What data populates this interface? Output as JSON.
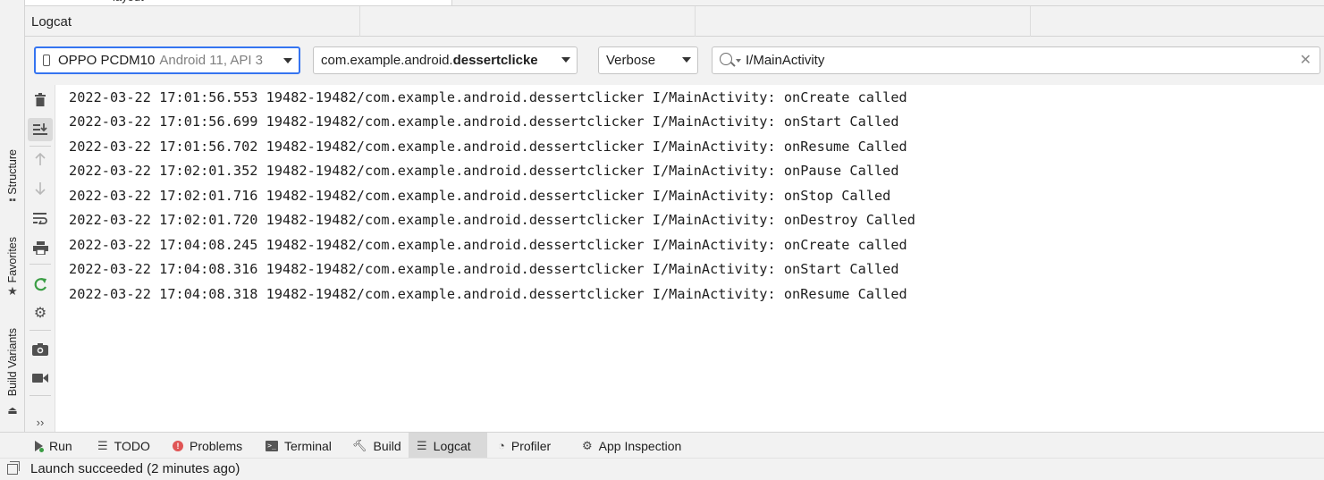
{
  "project_tree": {
    "partial_item": "layout"
  },
  "side_tabs": {
    "structure": "Structure",
    "favorites": "Favorites",
    "build_variants": "Build Variants"
  },
  "logcat": {
    "title": "Logcat",
    "device_select": {
      "device": "OPPO PCDM10",
      "detail": "Android 11, API 3"
    },
    "package_select": {
      "prefix": "com.example.android.",
      "bold": "dessertclicke"
    },
    "level_select": "Verbose",
    "search": {
      "value": "I/MainActivity",
      "clear_glyph": "✕"
    },
    "lines": [
      "2022-03-22 17:01:56.553 19482-19482/com.example.android.dessertclicker I/MainActivity: onCreate called",
      "2022-03-22 17:01:56.699 19482-19482/com.example.android.dessertclicker I/MainActivity: onStart Called",
      "2022-03-22 17:01:56.702 19482-19482/com.example.android.dessertclicker I/MainActivity: onResume Called",
      "2022-03-22 17:02:01.352 19482-19482/com.example.android.dessertclicker I/MainActivity: onPause Called",
      "2022-03-22 17:02:01.716 19482-19482/com.example.android.dessertclicker I/MainActivity: onStop Called",
      "2022-03-22 17:02:01.720 19482-19482/com.example.android.dessertclicker I/MainActivity: onDestroy Called",
      "2022-03-22 17:04:08.245 19482-19482/com.example.android.dessertclicker I/MainActivity: onCreate called",
      "2022-03-22 17:04:08.316 19482-19482/com.example.android.dessertclicker I/MainActivity: onStart Called",
      "2022-03-22 17:04:08.318 19482-19482/com.example.android.dessertclicker I/MainActivity: onResume Called"
    ]
  },
  "side_tools": {
    "more_glyph": "››",
    "icons": [
      "trash-icon",
      "scroll-to-end-icon",
      "up-arrow-icon",
      "down-arrow-icon",
      "soft-wrap-icon",
      "print-icon",
      "restart-icon",
      "settings-icon",
      "screenshot-icon",
      "screen-record-icon"
    ]
  },
  "bottom_tabs": {
    "run": "Run",
    "todo": "TODO",
    "problems": "Problems",
    "terminal": "Terminal",
    "build": "Build",
    "logcat": "Logcat",
    "profiler": "Profiler",
    "app_inspection": "App Inspection"
  },
  "status": {
    "message": "Launch succeeded (2 minutes ago)"
  },
  "colors": {
    "accent": "#3574f0",
    "run_green": "#3a9d44",
    "error_red": "#e05555"
  }
}
